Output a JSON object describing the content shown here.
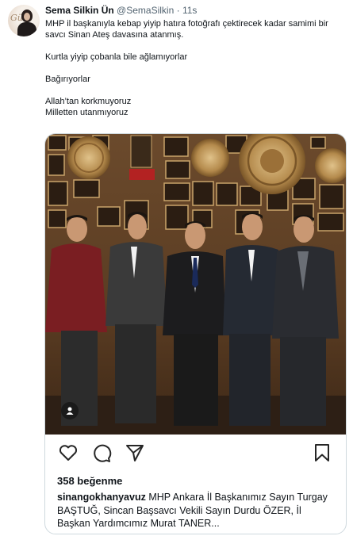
{
  "author": {
    "name": "Sema Silkin Ün",
    "handle": "@SemaSilkin",
    "dot": "·",
    "time": "11s"
  },
  "tweet_lines": [
    "MHP il başkanıyla kebap yiyip hatıra fotoğrafı çektirecek kadar samimi bir savcı Sinan Ateş davasına atanmış.",
    "Kurtla yiyip çobanla bile ağlamıyorlar",
    "Bağırıyorlar",
    "Allah’tan korkmuyoruz",
    "Milletten utanmıyoruz"
  ],
  "embed": {
    "likes": "358 beğenme",
    "caption_user": "sinangokhanyavuz",
    "caption_text": "MHP Ankara İl Başkanımız Sayın Turgay BAŞTUĞ, Sincan Başsavcı Vekili Sayın Durdu ÖZER, İl Başkan Yardımcımız Murat TANER..."
  },
  "icons": [
    "heart-icon",
    "comment-icon",
    "share-icon",
    "bookmark-icon",
    "user-tag-icon"
  ],
  "colors": {
    "text": "#0f1419",
    "muted": "#536471",
    "border": "#cfd9de"
  }
}
